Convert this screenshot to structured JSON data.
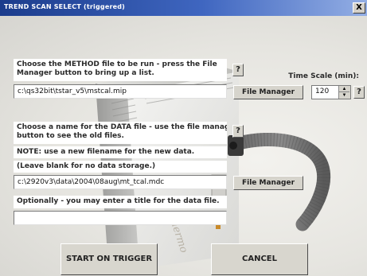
{
  "window": {
    "title": "TREND SCAN SELECT (triggered)",
    "close_label": "X"
  },
  "method": {
    "label_line1": "Choose the METHOD file to be run - press the File",
    "label_line2": "Manager button to bring up a list.",
    "path": "c:\\qs32bit\\tstar_v5\\mstcal.mip",
    "file_manager_label": "File Manager",
    "help_label": "?"
  },
  "time_scale": {
    "label": "Time Scale (min):",
    "value": "120",
    "help_label": "?"
  },
  "data_file": {
    "label_line1": "Choose a name for the DATA file - use the file manager",
    "label_line2": "button to see the old files.",
    "note": "NOTE: use a new filename for the new data.",
    "leave_blank": "(Leave blank for no data storage.)",
    "path": "c:\\2920v3\\data\\2004\\08aug\\mt_tcal.mdc",
    "file_manager_label": "File Manager",
    "help_label": "?"
  },
  "title_entry": {
    "label": "Optionally - you may enter a title for the data file.",
    "value": ""
  },
  "actions": {
    "start_label": "START ON TRIGGER",
    "cancel_label": "CANCEL"
  },
  "colors": {
    "titlebar": "#1b3c8c",
    "panel": "#e8e7e2",
    "button_face": "#d6d4cc"
  }
}
